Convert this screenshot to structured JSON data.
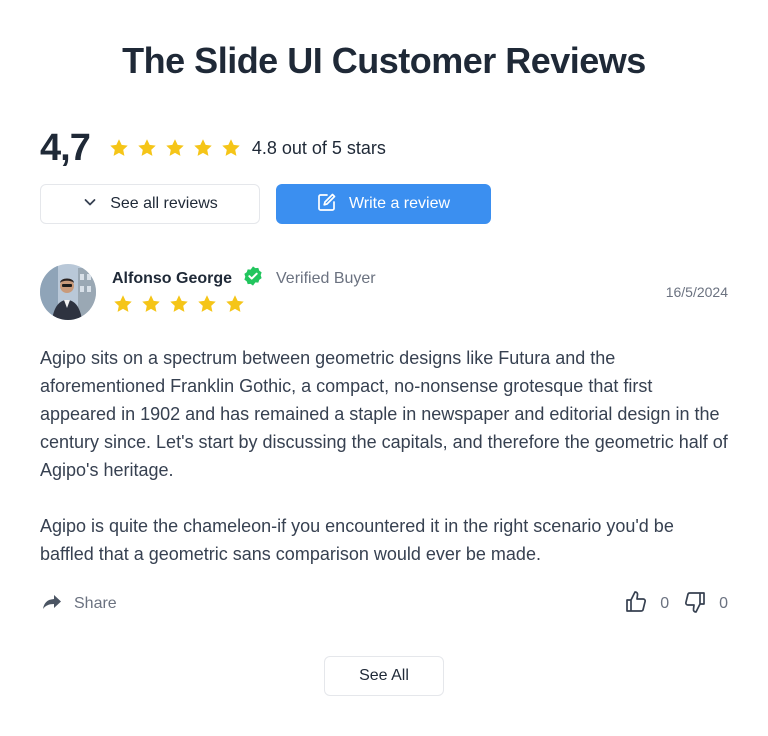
{
  "page": {
    "title": "The Slide UI Customer Reviews"
  },
  "summary": {
    "average": "4,7",
    "stars": 5,
    "rating_text": "4.8 out of 5 stars",
    "star_color": "#f5c518"
  },
  "actions": {
    "see_all_reviews": "See all reviews",
    "write_review": "Write a review",
    "primary_color": "#3b8ff0"
  },
  "review": {
    "reviewer_name": "Alfonso George",
    "verified_label": "Verified Buyer",
    "verified_color": "#22c55e",
    "stars": 5,
    "date": "16/5/2024",
    "paragraphs": [
      "Agipo sits on a spectrum between geometric designs like Futura and the aforementioned Franklin Gothic, a compact, no-nonsense grotesque that first appeared in 1902 and has remained a staple in newspaper and editorial design in the century since. Let's start by discussing the capitals, and therefore the geometric half of Agipo's heritage.",
      "Agipo is quite the chameleon-if you encountered it in the right scenario you'd be baffled that a geometric sans comparison would ever be made."
    ],
    "share_label": "Share",
    "likes": "0",
    "dislikes": "0"
  },
  "footer": {
    "see_all": "See All"
  },
  "icons": {
    "chevron": "chevron-down-icon",
    "edit": "edit-icon",
    "verified": "verified-badge-icon",
    "share": "share-arrow-icon",
    "like": "thumbs-up-icon",
    "dislike": "thumbs-down-icon"
  }
}
